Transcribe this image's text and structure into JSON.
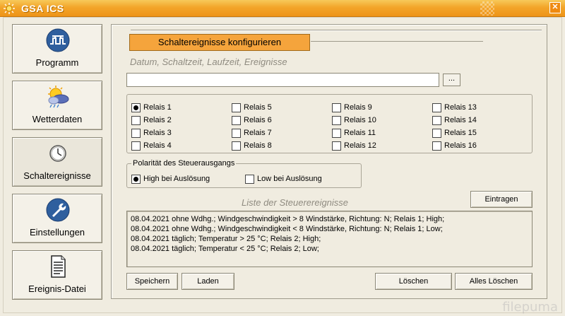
{
  "window": {
    "title": "GSA ICS",
    "close_label": "✕"
  },
  "nav": [
    {
      "label": "Programm",
      "icon": "program-icon"
    },
    {
      "label": "Wetterdaten",
      "icon": "weather-icon"
    },
    {
      "label": "Schaltereignisse",
      "icon": "clock-icon",
      "active": true
    },
    {
      "label": "Einstellungen",
      "icon": "settings-icon"
    },
    {
      "label": "Ereignis-Datei",
      "icon": "document-icon"
    }
  ],
  "main": {
    "header": "Schaltereignisse konfigurieren",
    "section_title": "Datum, Schaltzeit, Laufzeit, Ereignisse",
    "input_value": "",
    "browse_label": "...",
    "relays": [
      {
        "label": "Relais 1",
        "checked": true
      },
      {
        "label": "Relais 2",
        "checked": false
      },
      {
        "label": "Relais 3",
        "checked": false
      },
      {
        "label": "Relais 4",
        "checked": false
      },
      {
        "label": "Relais 5",
        "checked": false
      },
      {
        "label": "Relais 6",
        "checked": false
      },
      {
        "label": "Relais 7",
        "checked": false
      },
      {
        "label": "Relais 8",
        "checked": false
      },
      {
        "label": "Relais 9",
        "checked": false
      },
      {
        "label": "Relais 10",
        "checked": false
      },
      {
        "label": "Relais 11",
        "checked": false
      },
      {
        "label": "Relais 12",
        "checked": false
      },
      {
        "label": "Relais 13",
        "checked": false
      },
      {
        "label": "Relais 14",
        "checked": false
      },
      {
        "label": "Relais 15",
        "checked": false
      },
      {
        "label": "Relais 16",
        "checked": false
      }
    ],
    "polarity": {
      "legend": "Polarität des Steuerausgangs",
      "high_label": "High bei Auslösung",
      "high_checked": true,
      "low_label": "Low bei Auslösung",
      "low_checked": false
    },
    "list_title": "Liste der Steuerereignisse",
    "eintragen_label": "Eintragen",
    "events": [
      "08.04.2021 ohne Wdhg.; Windgeschwindigkeit > 8 Windstärke, Richtung: N; Relais 1; High;",
      "08.04.2021 ohne Wdhg.; Windgeschwindigkeit < 8 Windstärke, Richtung: N; Relais 1; Low;",
      "08.04.2021 täglich; Temperatur > 25 °C; Relais 2; High;",
      "08.04.2021 täglich; Temperatur < 25 °C; Relais 2; Low;"
    ],
    "buttons": {
      "speichern": "Speichern",
      "laden": "Laden",
      "loeschen": "Löschen",
      "alles_loeschen": "Alles Löschen"
    }
  },
  "watermark": "filepuma",
  "colors": {
    "titlebar": "#f3a52a",
    "header": "#f5a43c",
    "background": "#f0ece0"
  }
}
